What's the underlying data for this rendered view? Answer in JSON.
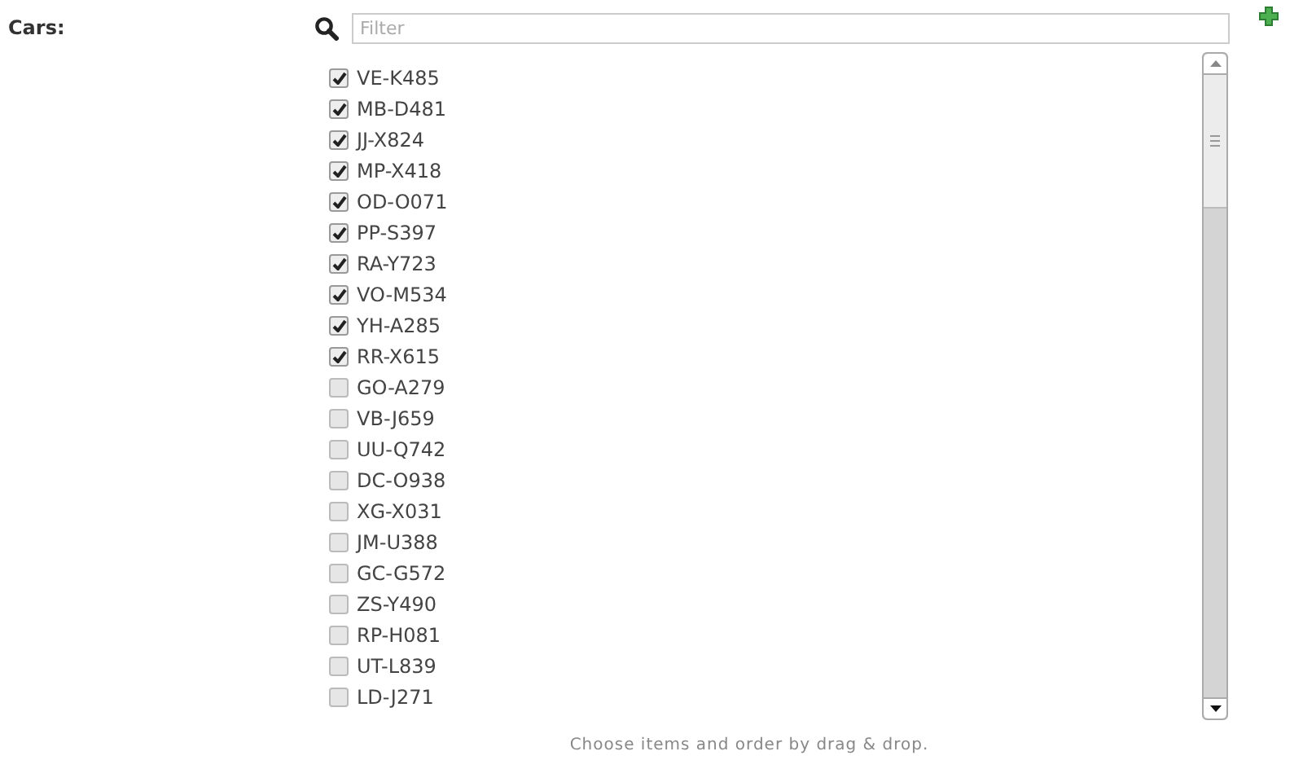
{
  "label": "Cars:",
  "filter": {
    "placeholder": "Filter"
  },
  "cars": [
    {
      "name": "VE-K485",
      "checked": true
    },
    {
      "name": "MB-D481",
      "checked": true
    },
    {
      "name": "JJ-X824",
      "checked": true
    },
    {
      "name": "MP-X418",
      "checked": true
    },
    {
      "name": "OD-O071",
      "checked": true
    },
    {
      "name": "PP-S397",
      "checked": true
    },
    {
      "name": "RA-Y723",
      "checked": true
    },
    {
      "name": "VO-M534",
      "checked": true
    },
    {
      "name": "YH-A285",
      "checked": true
    },
    {
      "name": "RR-X615",
      "checked": true
    },
    {
      "name": "GO-A279",
      "checked": false
    },
    {
      "name": "VB-J659",
      "checked": false
    },
    {
      "name": "UU-Q742",
      "checked": false
    },
    {
      "name": "DC-O938",
      "checked": false
    },
    {
      "name": "XG-X031",
      "checked": false
    },
    {
      "name": "JM-U388",
      "checked": false
    },
    {
      "name": "GC-G572",
      "checked": false
    },
    {
      "name": "ZS-Y490",
      "checked": false
    },
    {
      "name": "RP-H081",
      "checked": false
    },
    {
      "name": "UT-L839",
      "checked": false
    },
    {
      "name": "LD-J271",
      "checked": false
    }
  ],
  "hint": "Choose items and order by drag & drop."
}
